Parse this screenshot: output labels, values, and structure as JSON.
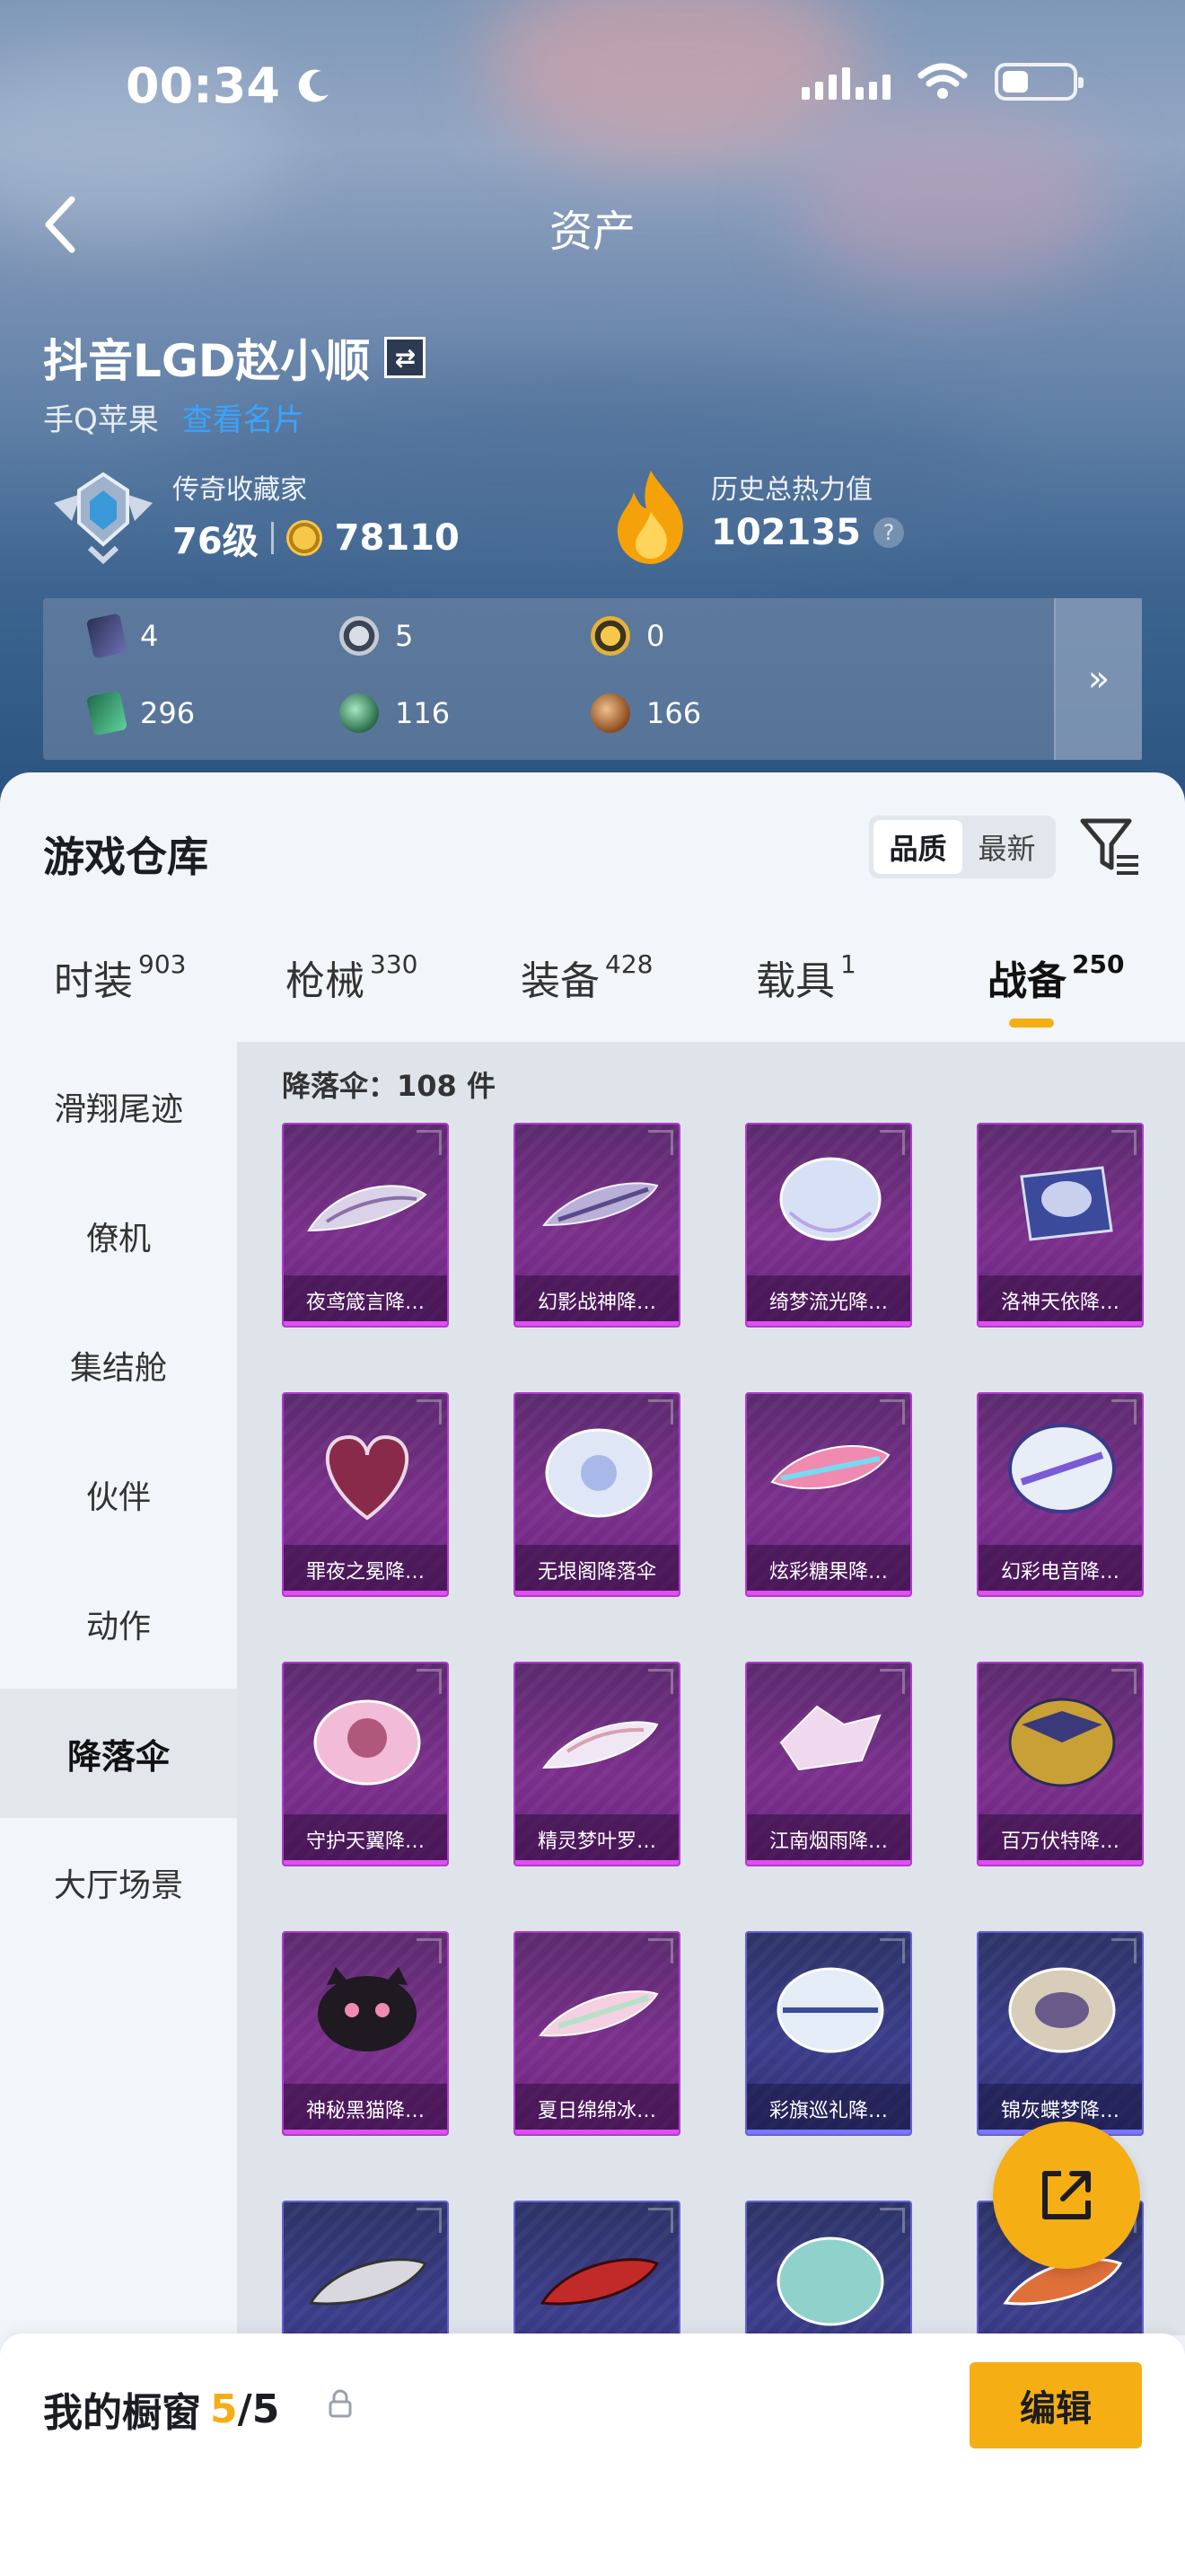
{
  "status_bar": {
    "time": "00:34"
  },
  "nav": {
    "title": "资产"
  },
  "player": {
    "name": "抖音LGD赵小顺",
    "platform": "手Q苹果",
    "link": "查看名片",
    "rank_title": "传奇收藏家",
    "level": "76级",
    "coins": "78110",
    "heat_title": "历史总热力值",
    "heat_value": "102135"
  },
  "resources": [
    {
      "value": "4",
      "icon": "card-icon"
    },
    {
      "value": "5",
      "icon": "silver-token-icon"
    },
    {
      "value": "0",
      "icon": "gold-token-icon"
    },
    {
      "value": "296",
      "icon": "green-card-icon"
    },
    {
      "value": "116",
      "icon": "green-orb-icon"
    },
    {
      "value": "166",
      "icon": "bronze-orb-icon"
    }
  ],
  "resources_more": "»",
  "warehouse": {
    "title": "游戏仓库",
    "sort_options": [
      "品质",
      "最新"
    ],
    "sort_active": "品质",
    "tabs": [
      {
        "label": "时装",
        "count": "903"
      },
      {
        "label": "枪械",
        "count": "330"
      },
      {
        "label": "装备",
        "count": "428"
      },
      {
        "label": "载具",
        "count": "1"
      },
      {
        "label": "战备",
        "count": "250"
      }
    ],
    "active_tab": "战备",
    "side_items": [
      "滑翔尾迹",
      "僚机",
      "集结舱",
      "伙伴",
      "动作",
      "降落伞",
      "大厅场景"
    ],
    "active_side": "降落伞",
    "count_text": "降落伞：108 件",
    "items": [
      {
        "name": "夜鸢箴言降…",
        "rarity": "purple"
      },
      {
        "name": "幻影战神降…",
        "rarity": "purple"
      },
      {
        "name": "绮梦流光降…",
        "rarity": "purple"
      },
      {
        "name": "洛神天依降…",
        "rarity": "purple"
      },
      {
        "name": "罪夜之冕降…",
        "rarity": "purple"
      },
      {
        "name": "无垠阁降落伞",
        "rarity": "purple"
      },
      {
        "name": "炫彩糖果降…",
        "rarity": "purple"
      },
      {
        "name": "幻彩电音降…",
        "rarity": "purple"
      },
      {
        "name": "守护天翼降…",
        "rarity": "purple"
      },
      {
        "name": "精灵梦叶罗…",
        "rarity": "purple"
      },
      {
        "name": "江南烟雨降…",
        "rarity": "purple"
      },
      {
        "name": "百万伏特降…",
        "rarity": "purple"
      },
      {
        "name": "神秘黑猫降…",
        "rarity": "purple"
      },
      {
        "name": "夏日绵绵冰…",
        "rarity": "purple"
      },
      {
        "name": "彩旗巡礼降…",
        "rarity": "blue"
      },
      {
        "name": "锦灰蝶梦降…",
        "rarity": "blue"
      },
      {
        "name": "",
        "rarity": "blue"
      },
      {
        "name": "",
        "rarity": "blue"
      },
      {
        "name": "",
        "rarity": "blue"
      },
      {
        "name": "",
        "rarity": "blue"
      }
    ]
  },
  "showcase": {
    "title": "我的橱窗",
    "current": "5",
    "total": "/5",
    "edit_label": "编辑"
  },
  "colors": {
    "accent": "#f5ae14",
    "link": "#3aa3ff",
    "purple_card": "#7a2f8b",
    "blue_card": "#3b3c8a"
  }
}
